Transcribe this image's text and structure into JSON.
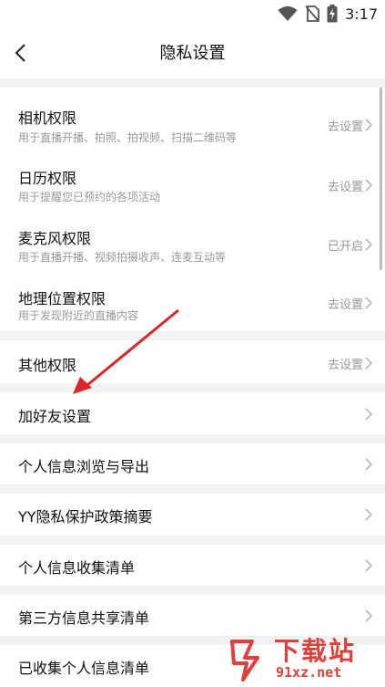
{
  "status_bar": {
    "time": "3:17"
  },
  "header": {
    "title": "隐私设置"
  },
  "permissions": [
    {
      "title": "相机权限",
      "subtitle": "用于直播开播、拍照、拍视频、扫描二维码等",
      "action": "去设置"
    },
    {
      "title": "日历权限",
      "subtitle": "用于提醒您已预约的各项活动",
      "action": "去设置"
    },
    {
      "title": "麦克风权限",
      "subtitle": "用于直播开播、视频拍摄收声、连麦互动等",
      "action": "已开启"
    },
    {
      "title": "地理位置权限",
      "subtitle": "用于发现附近的直播内容",
      "action": "去设置"
    }
  ],
  "other_permissions": {
    "title": "其他权限",
    "action": "去设置"
  },
  "menu_items": [
    {
      "title": "加好友设置"
    },
    {
      "title": "个人信息浏览与导出"
    },
    {
      "title": "YY隐私保护政策摘要"
    },
    {
      "title": "个人信息收集清单"
    },
    {
      "title": "第三方信息共享清单"
    },
    {
      "title": "已收集个人信息清单"
    }
  ],
  "watermark": {
    "text": "下载站",
    "url": "91xz.net"
  },
  "colors": {
    "annotation_arrow": "#d9262a",
    "watermark": "#e0403a"
  }
}
